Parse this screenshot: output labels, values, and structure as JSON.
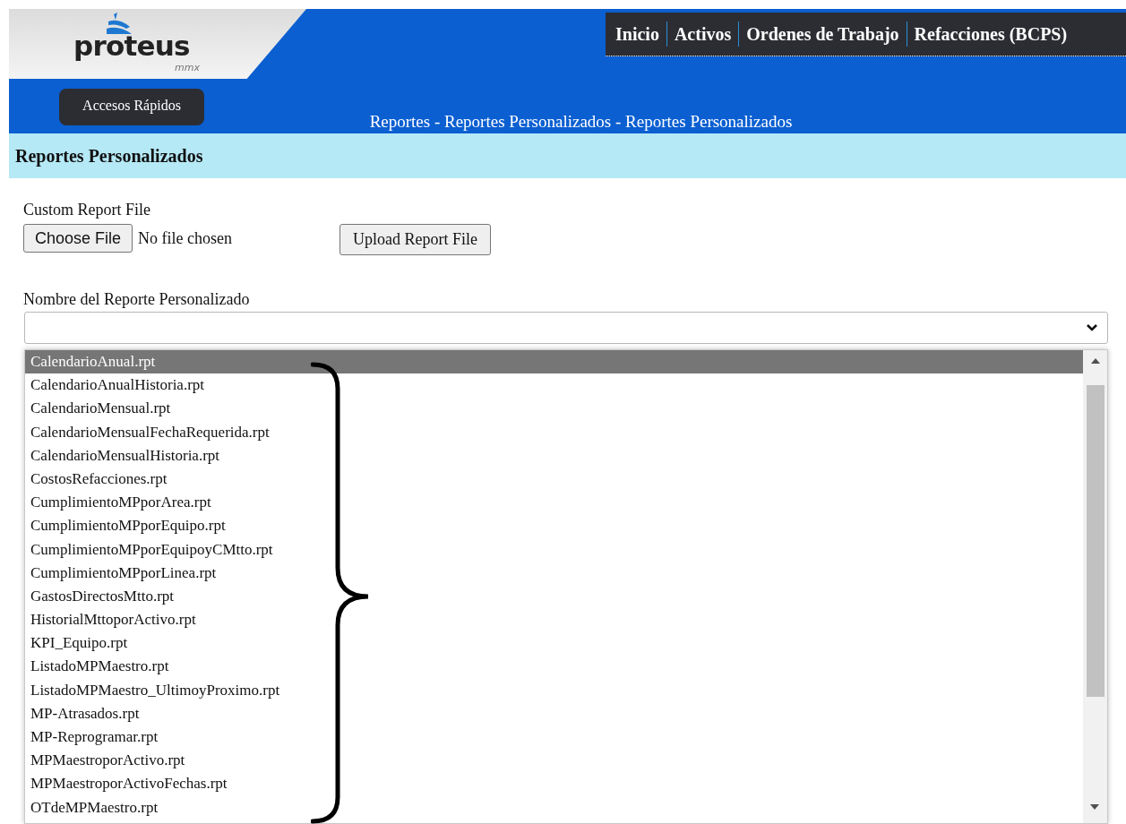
{
  "logo": {
    "name": "proteus",
    "sub": "mmx"
  },
  "nav": [
    {
      "label": "Inicio"
    },
    {
      "label": "Activos"
    },
    {
      "label": "Ordenes de Trabajo"
    },
    {
      "label": "Refacciones (BCPS)"
    }
  ],
  "quick_access_button": "Accesos Rápidos",
  "breadcrumb": "Reportes - Reportes Personalizados - Reportes Personalizados",
  "section_title": "Reportes Personalizados",
  "file_upload": {
    "label": "Custom Report File",
    "choose_button": "Choose File",
    "status": "No file chosen",
    "upload_button": "Upload Report File"
  },
  "report_select": {
    "label": "Nombre del Reporte Personalizado"
  },
  "report_list": [
    {
      "label": "CalendarioAnual.rpt",
      "selected": true
    },
    {
      "label": "CalendarioAnualHistoria.rpt",
      "selected": false
    },
    {
      "label": "CalendarioMensual.rpt",
      "selected": false
    },
    {
      "label": "CalendarioMensualFechaRequerida.rpt",
      "selected": false
    },
    {
      "label": "CalendarioMensualHistoria.rpt",
      "selected": false
    },
    {
      "label": "CostosRefacciones.rpt",
      "selected": false
    },
    {
      "label": "CumplimientoMPporArea.rpt",
      "selected": false
    },
    {
      "label": "CumplimientoMPporEquipo.rpt",
      "selected": false
    },
    {
      "label": "CumplimientoMPporEquipoyCMtto.rpt",
      "selected": false
    },
    {
      "label": "CumplimientoMPporLinea.rpt",
      "selected": false
    },
    {
      "label": "GastosDirectosMtto.rpt",
      "selected": false
    },
    {
      "label": "HistorialMttoporActivo.rpt",
      "selected": false
    },
    {
      "label": "KPI_Equipo.rpt",
      "selected": false
    },
    {
      "label": "ListadoMPMaestro.rpt",
      "selected": false
    },
    {
      "label": "ListadoMPMaestro_UltimoyProximo.rpt",
      "selected": false
    },
    {
      "label": "MP-Atrasados.rpt",
      "selected": false
    },
    {
      "label": "MP-Reprogramar.rpt",
      "selected": false
    },
    {
      "label": "MPMaestroporActivo.rpt",
      "selected": false
    },
    {
      "label": "MPMaestroporActivoFechas.rpt",
      "selected": false
    },
    {
      "label": "OTdeMPMaestro.rpt",
      "selected": false
    }
  ]
}
